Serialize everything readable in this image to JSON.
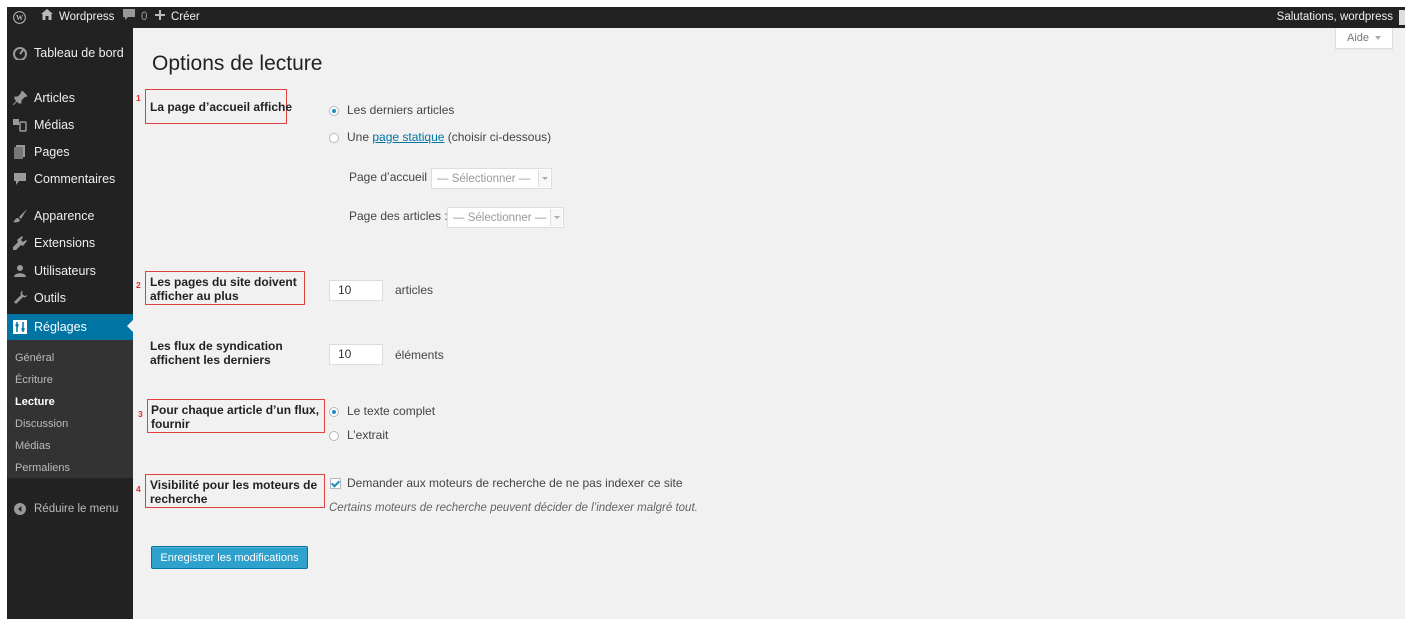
{
  "adminbar": {
    "site_name": "Wordpress",
    "comments_count": "0",
    "new_label": "Créer",
    "greeting": "Salutations, wordpress"
  },
  "menu": {
    "items": [
      {
        "label": "Tableau de bord",
        "icon": "dashboard-icon"
      },
      {
        "label": "Articles",
        "icon": "pin-icon"
      },
      {
        "label": "Médias",
        "icon": "media-icon"
      },
      {
        "label": "Pages",
        "icon": "pages-icon"
      },
      {
        "label": "Commentaires",
        "icon": "comment-icon"
      },
      {
        "label": "Apparence",
        "icon": "brush-icon"
      },
      {
        "label": "Extensions",
        "icon": "plugin-icon"
      },
      {
        "label": "Utilisateurs",
        "icon": "users-icon"
      },
      {
        "label": "Outils",
        "icon": "wrench-icon"
      },
      {
        "label": "Réglages",
        "icon": "settings-icon"
      }
    ],
    "submenu": [
      "Général",
      "Écriture",
      "Lecture",
      "Discussion",
      "Médias",
      "Permaliens"
    ],
    "collapse_label": "Réduire le menu"
  },
  "help_tab": "Aide",
  "page_title": "Options de lecture",
  "annotations": [
    "1",
    "2",
    "3",
    "4"
  ],
  "front_page": {
    "label": "La page d’accueil affiche",
    "option_latest": "Les derniers articles",
    "option_static_prefix": "Une",
    "option_static_link": "page statique",
    "option_static_suffix": "(choisir ci-dessous)",
    "selected": "latest",
    "homepage_label": "Page d’accueil :",
    "postspage_label": "Page des articles :",
    "select_placeholder": "— Sélectionner —"
  },
  "posts_per_page": {
    "label_line1": "Les pages du site doivent",
    "label_line2": "afficher au plus",
    "value": "10",
    "unit": "articles"
  },
  "posts_per_rss": {
    "label_line1": "Les flux de syndication",
    "label_line2": "affichent les derniers",
    "value": "10",
    "unit": "éléments"
  },
  "rss_use_excerpt": {
    "label_line1": "Pour chaque article d’un flux,",
    "label_line2": "fournir",
    "option_full": "Le texte complet",
    "option_excerpt": "L’extrait",
    "selected": "full"
  },
  "search_visibility": {
    "label_line1": "Visibilité pour les moteurs de",
    "label_line2": "recherche",
    "checkbox_label": "Demander aux moteurs de recherche de ne pas indexer ce site",
    "checked": true,
    "description": "Certains moteurs de recherche peuvent décider de l’indexer malgré tout."
  },
  "submit_label": "Enregistrer les modifications",
  "colors": {
    "adminbar_bg": "#222222",
    "menu_bg": "#222222",
    "menu_current": "#0074a2",
    "button": "#2ea2cc",
    "annotation": "#e04040",
    "content_bg": "#f1f1f1"
  }
}
